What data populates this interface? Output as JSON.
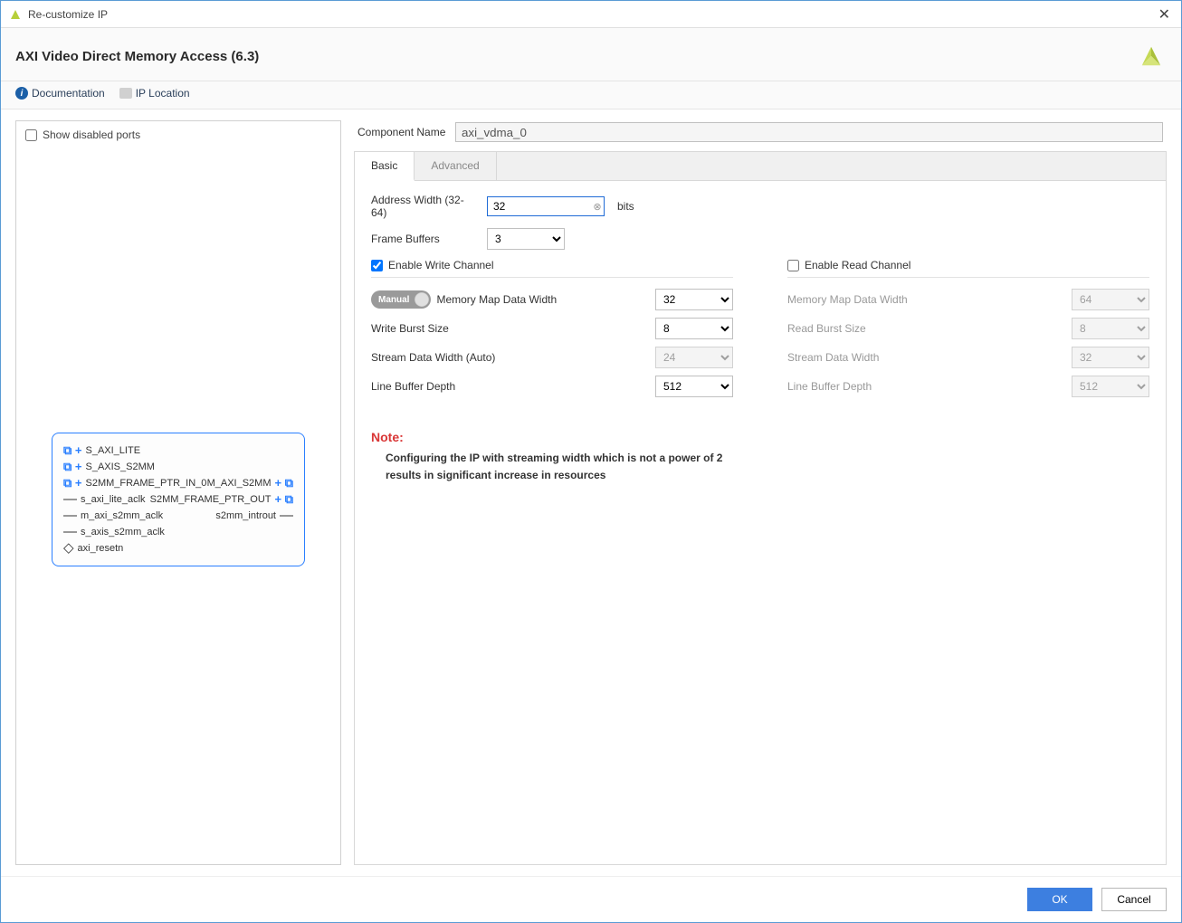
{
  "window": {
    "title": "Re-customize IP"
  },
  "header": {
    "ip_title": "AXI Video Direct Memory Access (6.3)"
  },
  "links": {
    "documentation": "Documentation",
    "ip_location": "IP Location"
  },
  "left": {
    "show_disabled_ports": "Show disabled ports",
    "ports": {
      "left": [
        "S_AXI_LITE",
        "S_AXIS_S2MM",
        "S2MM_FRAME_PTR_IN_0",
        "s_axi_lite_aclk",
        "m_axi_s2mm_aclk",
        "s_axis_s2mm_aclk",
        "axi_resetn"
      ],
      "right_bus": [
        "M_AXI_S2MM",
        "S2MM_FRAME_PTR_OUT"
      ],
      "right_wire": "s2mm_introut"
    }
  },
  "right": {
    "component_name_label": "Component Name",
    "component_name": "axi_vdma_0",
    "tabs": {
      "basic": "Basic",
      "advanced": "Advanced"
    },
    "address_width": {
      "label": "Address Width (32-64)",
      "value": "32",
      "suffix": "bits"
    },
    "frame_buffers": {
      "label": "Frame Buffers",
      "value": "3"
    },
    "write_channel": {
      "enable_label": "Enable Write Channel",
      "toggle": "Manual",
      "mm_width": {
        "label": "Memory Map Data Width",
        "value": "32"
      },
      "burst": {
        "label": "Write Burst Size",
        "value": "8"
      },
      "stream_width": {
        "label": "Stream Data Width (Auto)",
        "value": "24"
      },
      "line_buf": {
        "label": "Line Buffer Depth",
        "value": "512"
      }
    },
    "read_channel": {
      "enable_label": "Enable Read Channel",
      "mm_width": {
        "label": "Memory Map Data Width",
        "value": "64"
      },
      "burst": {
        "label": "Read Burst Size",
        "value": "8"
      },
      "stream_width": {
        "label": "Stream Data Width",
        "value": "32"
      },
      "line_buf": {
        "label": "Line Buffer Depth",
        "value": "512"
      }
    },
    "note": {
      "title": "Note:",
      "line1": "Configuring the IP with streaming width which is not a power of 2",
      "line2": "results in significant increase in resources"
    }
  },
  "footer": {
    "ok": "OK",
    "cancel": "Cancel"
  }
}
